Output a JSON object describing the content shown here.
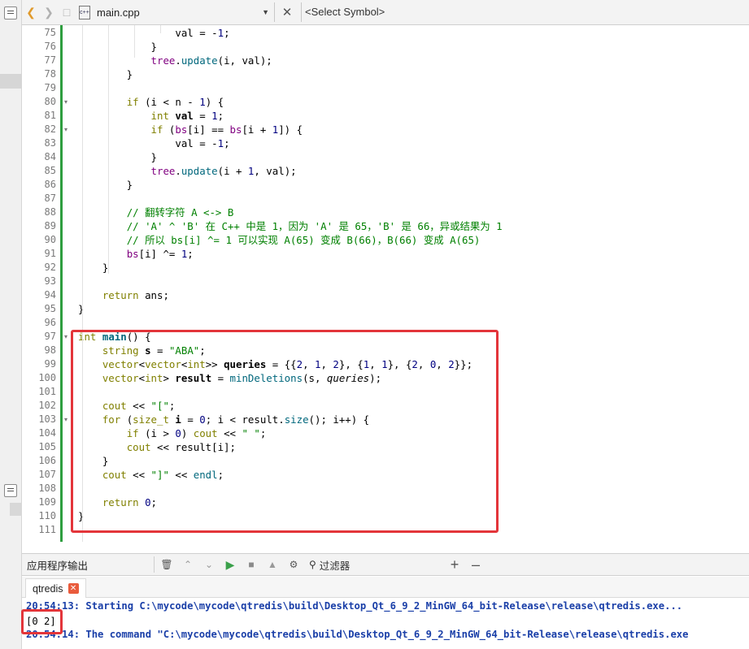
{
  "editor_toolbar": {
    "filename": "main.cpp",
    "symbol_placeholder": "<Select Symbol>",
    "file_icon_glyph": "c++"
  },
  "code": {
    "lines": [
      {
        "n": "75",
        "fold": false
      },
      {
        "n": "76",
        "fold": false
      },
      {
        "n": "77",
        "fold": false
      },
      {
        "n": "78",
        "fold": false
      },
      {
        "n": "79",
        "fold": false
      },
      {
        "n": "80",
        "fold": true
      },
      {
        "n": "81",
        "fold": false
      },
      {
        "n": "82",
        "fold": true
      },
      {
        "n": "83",
        "fold": false
      },
      {
        "n": "84",
        "fold": false
      },
      {
        "n": "85",
        "fold": false
      },
      {
        "n": "86",
        "fold": false
      },
      {
        "n": "87",
        "fold": false
      },
      {
        "n": "88",
        "fold": false
      },
      {
        "n": "89",
        "fold": false
      },
      {
        "n": "90",
        "fold": false
      },
      {
        "n": "91",
        "fold": false
      },
      {
        "n": "92",
        "fold": false
      },
      {
        "n": "93",
        "fold": false
      },
      {
        "n": "94",
        "fold": false
      },
      {
        "n": "95",
        "fold": false
      },
      {
        "n": "96",
        "fold": false
      },
      {
        "n": "97",
        "fold": true
      },
      {
        "n": "98",
        "fold": false
      },
      {
        "n": "99",
        "fold": false
      },
      {
        "n": "100",
        "fold": false
      },
      {
        "n": "101",
        "fold": false
      },
      {
        "n": "102",
        "fold": false
      },
      {
        "n": "103",
        "fold": true
      },
      {
        "n": "104",
        "fold": false
      },
      {
        "n": "105",
        "fold": false
      },
      {
        "n": "106",
        "fold": false
      },
      {
        "n": "107",
        "fold": false
      },
      {
        "n": "108",
        "fold": false
      },
      {
        "n": "109",
        "fold": false
      },
      {
        "n": "110",
        "fold": false
      },
      {
        "n": "111",
        "fold": false
      }
    ],
    "tokens": {
      "l75": [
        "                ",
        "val",
        " = -",
        "1",
        ";"
      ],
      "l76": [
        "            }"
      ],
      "l77": [
        "            ",
        "tree",
        ".",
        "update",
        "(i, val);"
      ],
      "l78": [
        "        }"
      ],
      "l80": [
        "        ",
        "if",
        " (i < n - ",
        "1",
        ") {"
      ],
      "l81": [
        "            ",
        "int",
        " ",
        "val",
        " = ",
        "1",
        ";"
      ],
      "l82": [
        "            ",
        "if",
        " (",
        "bs",
        "[i] == ",
        "bs",
        "[i + ",
        "1",
        "]) {"
      ],
      "l83": [
        "                ",
        "val",
        " = -",
        "1",
        ";"
      ],
      "l84": [
        "            }"
      ],
      "l85": [
        "            ",
        "tree",
        ".",
        "update",
        "(i + ",
        "1",
        ", val);"
      ],
      "l86": [
        "        }"
      ],
      "l88": [
        "        ",
        "// 翻转字符 A <-> B"
      ],
      "l89": [
        "        ",
        "// 'A' ^ 'B' 在 C++ 中是 1，因为 'A' 是 65，'B' 是 66，异或结果为 1"
      ],
      "l90": [
        "        ",
        "// 所以 bs[i] ^= 1 可以实现 A(65) 变成 B(66)，B(66) 变成 A(65)"
      ],
      "l91": [
        "        ",
        "bs",
        "[i] ^= ",
        "1",
        ";"
      ],
      "l92": [
        "    }"
      ],
      "l94": [
        "    ",
        "return",
        " ans;"
      ],
      "l95": [
        "}"
      ],
      "l97": [
        "int",
        " ",
        "main",
        "() {"
      ],
      "l98": [
        "    ",
        "string",
        " ",
        "s",
        " = ",
        "\"ABA\"",
        ";"
      ],
      "l99": [
        "    ",
        "vector",
        "<",
        "vector",
        "<",
        "int",
        ">> ",
        "queries",
        " = {{",
        "2",
        ", ",
        "1",
        ", ",
        "2",
        "}, {",
        "1",
        ", ",
        "1",
        "}, {",
        "2",
        ", ",
        "0",
        ", ",
        "2",
        "}};"
      ],
      "l100": [
        "    ",
        "vector",
        "<",
        "int",
        "> ",
        "result",
        " = ",
        "minDeletions",
        "(s, ",
        "queries",
        ");"
      ],
      "l102": [
        "    ",
        "cout",
        " << ",
        "\"[\"",
        ";"
      ],
      "l103": [
        "    ",
        "for",
        " (",
        "size_t",
        " ",
        "i",
        " = ",
        "0",
        "; i < result.",
        "size",
        "(); i++) {"
      ],
      "l104": [
        "        ",
        "if",
        " (i > ",
        "0",
        ") ",
        "cout",
        " << ",
        "\" \"",
        ";"
      ],
      "l105": [
        "        ",
        "cout",
        " << result[i];"
      ],
      "l106": [
        "    }"
      ],
      "l107": [
        "    ",
        "cout",
        " << ",
        "\"]\"",
        " << ",
        "endl",
        ";"
      ],
      "l109": [
        "    ",
        "return",
        " ",
        "0",
        ";"
      ],
      "l110": [
        "}"
      ]
    }
  },
  "output_pane": {
    "title": "应用程序输出",
    "filter_placeholder": "过滤器",
    "tab_label": "qtredis",
    "lines": [
      "20:54:13: Starting C:\\mycode\\mycode\\qtredis\\build\\Desktop_Qt_6_9_2_MinGW_64_bit-Release\\release\\qtredis.exe...",
      "[0 2]",
      "20:54:14: The command \"C:\\mycode\\mycode\\qtredis\\build\\Desktop_Qt_6_9_2_MinGW_64_bit-Release\\release\\qtredis.exe"
    ]
  },
  "colors": {
    "keyword": "#808000",
    "function": "#00677c",
    "string": "#008000",
    "number": "#000080",
    "type_user": "#800080",
    "highlight_border": "#e3353a",
    "change_bar": "#2e9e3f",
    "output_blue": "#1a3fa8"
  },
  "icons": {
    "back": "chevron-left-icon",
    "forward": "chevron-right-icon",
    "lock": "lock-icon",
    "close_file": "close-icon",
    "run": "play-icon",
    "stop": "stop-icon",
    "settings": "gear-icon",
    "filter": "search-icon",
    "trash": "trash-icon"
  }
}
